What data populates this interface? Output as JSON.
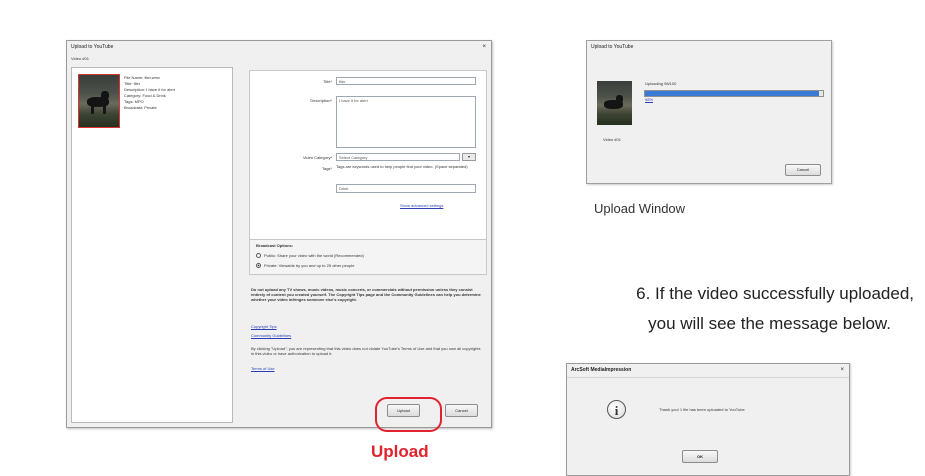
{
  "main_dialog": {
    "title": "Upload to YouTube",
    "close_glyph": "×",
    "video_label": "Video #01",
    "info": [
      "File Name: filer.wmv",
      "Title: filer",
      "Description: I have it for alert",
      "Category: Food & Drink",
      "Tags: MPO",
      "Broadcast: Private"
    ],
    "form": {
      "title_label": "Title*",
      "title_value": "filer",
      "description_label": "Description*",
      "description_value": "I have it for alert",
      "category_label": "Video Category*",
      "category_value": "Select Category",
      "tags_label": "Tags*",
      "tags_hint": "Tags are keywords used to help people find your video. (Space separated)",
      "tags_value": "Drink",
      "more_link": "Show advanced settings"
    },
    "broadcast": {
      "heading": "Broadcast Options:",
      "option_public": "Public: Share your video with the world (Recommended)",
      "option_private": "Private: Viewable by you and up to 25 other people"
    },
    "notice": "Do not upload any TV shows, music videos, music concerts, or commercials without permission unless they consist entirely of content you created yourself. The Copyright Tips page and the Community Guidelines can help you determine whether your video infringes someone else's copyright.",
    "link1": "Copyright Tips",
    "link2": "Community Guidelines",
    "agree_text": "By clicking \"Upload\", you are representing that this video does not violate YouTube's Terms of Use and that you own all copyrights in this video or have authorization to upload it.",
    "terms_link": "Terms of Use",
    "upload_button": "Upload",
    "cancel_button": "Cancel"
  },
  "upload_caption": "Upload",
  "upload_window": {
    "title": "Upload to YouTube",
    "status": "Uploading 98/100",
    "percent_text": "98%",
    "progress": 0.98,
    "sub_label": "Video #01",
    "cancel_button": "Cancel",
    "caption": "Upload Window"
  },
  "step_text_line1": "6. If the video successfully uploaded,",
  "step_text_line2": "you will see the message below.",
  "success_dialog": {
    "title": "ArcSoft MediaImpression",
    "close_glyph": "×",
    "message": "Thank you! 1 file has been uploaded to YouTube",
    "ok_button": "OK"
  },
  "colors": {
    "highlight": "#e0232f",
    "progress": "#3a7bd5"
  }
}
